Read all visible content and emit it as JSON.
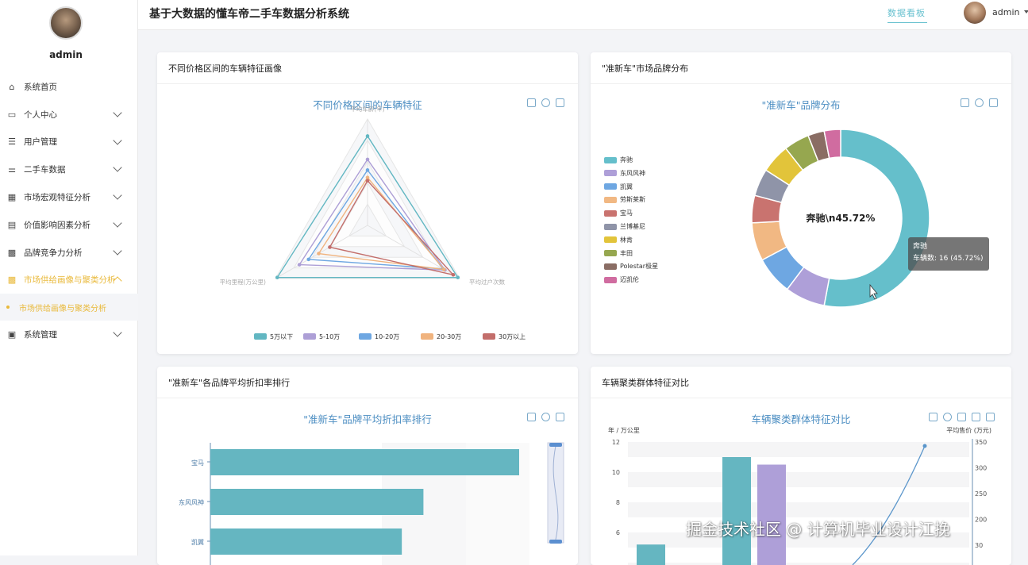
{
  "app": {
    "title": "基于大数据的懂车帝二手车数据分析系统",
    "dashboard_link": "数据看板"
  },
  "user": {
    "name": "admin"
  },
  "sidebar": {
    "username": "admin",
    "items": [
      {
        "label": "系统首页",
        "icon": "home-icon",
        "glyph": "⌂",
        "chevron": false
      },
      {
        "label": "个人中心",
        "icon": "card-icon",
        "glyph": "▭",
        "chevron": true
      },
      {
        "label": "用户管理",
        "icon": "list-icon",
        "glyph": "☰",
        "chevron": true
      },
      {
        "label": "二手车数据",
        "icon": "sliders-icon",
        "glyph": "⚌",
        "chevron": true
      },
      {
        "label": "市场宏观特征分析",
        "icon": "grid-icon",
        "glyph": "▦",
        "chevron": true
      },
      {
        "label": "价值影响因素分析",
        "icon": "clipboard-icon",
        "glyph": "▤",
        "chevron": true
      },
      {
        "label": "品牌竞争力分析",
        "icon": "apps-icon",
        "glyph": "▩",
        "chevron": true
      },
      {
        "label": "市场供给画像与聚类分析",
        "icon": "apps-icon",
        "glyph": "▩",
        "chevron": true,
        "active": true
      },
      {
        "label": "系统管理",
        "icon": "check-clipboard-icon",
        "glyph": "▣",
        "chevron": true
      }
    ],
    "sub_item": "市场供给画像与聚类分析"
  },
  "cards": {
    "radar": {
      "header": "不同价格区间的车辆特征画像",
      "title": "不同价格区间的车辆特征"
    },
    "pie": {
      "header": "\"准新车\"市场品牌分布",
      "title": "\"准新车\"品牌分布"
    },
    "bar": {
      "header": "\"准新车\"各品牌平均折扣率排行",
      "title": "\"准新车\"品牌平均折扣率排行"
    },
    "cluster": {
      "header": "车辆聚类群体特征对比",
      "title": "车辆聚类群体特征对比"
    }
  },
  "tooltip": {
    "line1": "奔驰",
    "line2": "车辆数: 16 (45.72%)"
  },
  "watermark": "掘金技术社区 @ 计算机毕业设计江挽",
  "colors": {
    "accent": "#e9b93a",
    "teal": "#68c1cf",
    "title_blue": "#4c8ec2"
  },
  "chart_data": [
    {
      "type": "radar",
      "indicators": [
        "平均车龄(年)",
        "平均里程(万公里)",
        "平均过户次数"
      ],
      "legend": [
        "5万以下",
        "5-10万",
        "10-20万",
        "20-30万",
        "30万以上"
      ],
      "series": [
        {
          "name": "5万以下",
          "values": [
            0.84,
            0.98,
            0.98
          ],
          "color": "#62b7c2"
        },
        {
          "name": "5-10万",
          "values": [
            0.62,
            0.74,
            0.84
          ],
          "color": "#ad9fd6"
        },
        {
          "name": "10-20万",
          "values": [
            0.52,
            0.64,
            0.82
          ],
          "color": "#6ea7e2"
        },
        {
          "name": "20-30万",
          "values": [
            0.45,
            0.53,
            0.83
          ],
          "color": "#f0b37e"
        },
        {
          "name": "30万以上",
          "values": [
            0.42,
            0.41,
            0.93
          ],
          "color": "#c36e6b"
        }
      ]
    },
    {
      "type": "pie",
      "center_label": "奔驰\\n45.72%",
      "slices": [
        {
          "name": "奔驰",
          "value": 16,
          "color": "#65bfcb"
        },
        {
          "name": "东风风神",
          "value": 2.2,
          "color": "#ae9fd8"
        },
        {
          "name": "凯翼",
          "value": 2.1,
          "color": "#6ea7e2"
        },
        {
          "name": "劳斯莱斯",
          "value": 2.1,
          "color": "#f1b883"
        },
        {
          "name": "宝马",
          "value": 1.5,
          "color": "#c9736f"
        },
        {
          "name": "兰博基尼",
          "value": 1.5,
          "color": "#8f94a8"
        },
        {
          "name": "林肯",
          "value": 1.6,
          "color": "#e2c43a"
        },
        {
          "name": "丰田",
          "value": 1.4,
          "color": "#96a74f"
        },
        {
          "name": "Polestar极星",
          "value": 0.9,
          "color": "#8a6d64"
        },
        {
          "name": "迈凯伦",
          "value": 0.9,
          "color": "#d06ca0"
        }
      ]
    },
    {
      "type": "bar",
      "orientation": "horizontal",
      "categories": [
        "宝马",
        "东风风神",
        "凯翼"
      ],
      "values": [
        1.0,
        0.69,
        0.62
      ],
      "color": "#65b6c1"
    },
    {
      "type": "bar",
      "title": "车辆聚类群体特征对比",
      "ylabel": "年 / 万公里",
      "y2label": "平均售价 (万元)",
      "y_ticks": [
        "12",
        "10",
        "8",
        "6"
      ],
      "y2_ticks": [
        "350",
        "300",
        "250",
        "200",
        "30"
      ],
      "ylim": [
        4.5,
        12
      ],
      "bars": [
        {
          "value": 5.2,
          "color": "#65b6c1"
        },
        {
          "value": 11,
          "color": "#65b6c1"
        },
        {
          "value": 10.5,
          "color": "#ae9fd8"
        }
      ],
      "line_color": "#5b96cb"
    }
  ]
}
